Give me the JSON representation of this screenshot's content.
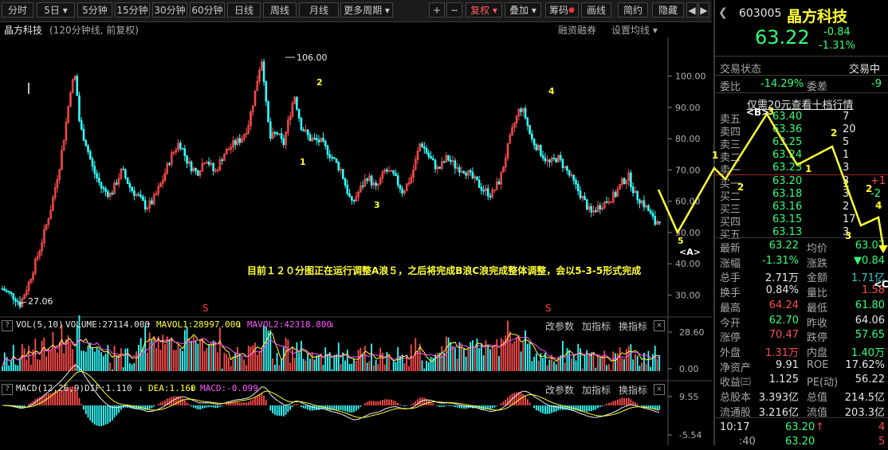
{
  "toolbar": {
    "periods": [
      "分时",
      "5日",
      "5分钟",
      "15分钟",
      "30分钟",
      "60分钟",
      "日线",
      "周线",
      "月线",
      "更多周期"
    ],
    "plus": "+",
    "minus": "−",
    "fuquan": "复权",
    "overlay": "叠加",
    "chips": "筹码",
    "draw": "画线",
    "simple": "简约",
    "hide": "隐藏",
    "prev_arrow": "◀",
    "next_arrow": "▶"
  },
  "chart": {
    "stock_name": "晶方科技",
    "sub_title": "(120分钟线, 前复权)",
    "margin_trading": "融资融券",
    "ma_settings": "设置均线",
    "annotation": "目前１２０分图正在运行调整A浪５，之后将完成B浪C浪完成整体调整，会以5-3-5形式完成",
    "high_label": "106.00",
    "low_label": "27.06",
    "wave_labels": [
      "1",
      "2",
      "3",
      "4",
      "5",
      "<A>",
      "S",
      "S"
    ]
  },
  "chart_data": {
    "type": "candlestick",
    "y_ticks": [
      "100.00",
      "90.00",
      "80.00",
      "70.00",
      "60.00",
      "50.00",
      "40.00",
      "30.00"
    ],
    "ylim": [
      27.06,
      106.0
    ],
    "high": 106.0,
    "low": 27.06,
    "waves": [
      {
        "label": "1",
        "price": 66
      },
      {
        "label": "2",
        "price": 95
      },
      {
        "label": "3",
        "price": 57
      },
      {
        "label": "4",
        "price": 91
      },
      {
        "label": "5",
        "price": 50
      },
      {
        "label": "<A>",
        "price": 50
      }
    ]
  },
  "volume_panel": {
    "title": "VOL(5,10)",
    "volume": "VOLUME:27114.000",
    "ma1": "MAVOL1:28997.000",
    "ma2": "MAVOL2:42318.800",
    "btn_params": "改参数",
    "btn_add": "加指标",
    "btn_switch": "换指标",
    "close": "✕",
    "y_ticks": [
      "28.60",
      "0.00"
    ]
  },
  "macd_panel": {
    "title": "MACD(12,26,9)",
    "dif": "DIF:1.110",
    "dea": "DEA:1.160",
    "macd": "MACD:-0.099",
    "btn_params": "改参数",
    "btn_add": "加指标",
    "btn_switch": "换指标",
    "close": "✕",
    "y_ticks": [
      "9.55",
      "-5.54"
    ]
  },
  "sidebar": {
    "code": "603005",
    "name": "晶方科技",
    "price": "63.22",
    "change": "-0.84",
    "change_pct": "-1.31%",
    "status_label": "交易状态",
    "status_value": "交易中",
    "webi_label": "委比",
    "webi_value": "-14.29%",
    "weicha_label": "委差",
    "weicha_value": "-9",
    "promo": "仅需20元查看十档行情",
    "asks": [
      {
        "label": "卖五",
        "price": "63.40",
        "vol": "7"
      },
      {
        "label": "卖四",
        "price": "63.36",
        "vol": "20"
      },
      {
        "label": "卖三",
        "price": "63.25",
        "vol": "5"
      },
      {
        "label": "卖二",
        "price": "63.24",
        "vol": "1"
      },
      {
        "label": "卖一",
        "price": "63.23",
        "vol": "3"
      }
    ],
    "bids": [
      {
        "label": "买一",
        "price": "63.20",
        "vol": "3",
        "delta": "+1"
      },
      {
        "label": "买二",
        "price": "63.18",
        "vol": "3",
        "delta": "-2"
      },
      {
        "label": "买三",
        "price": "63.16",
        "vol": "2",
        "delta": ""
      },
      {
        "label": "买四",
        "price": "63.15",
        "vol": "17",
        "delta": ""
      },
      {
        "label": "买五",
        "price": "63.13",
        "vol": "3",
        "delta": ""
      }
    ],
    "stats": [
      {
        "l1": "最新",
        "v1": "63.22",
        "c1": "green",
        "l2": "均价",
        "v2": "63.07",
        "c2": "green"
      },
      {
        "l1": "涨幅",
        "v1": "-1.31%",
        "c1": "green",
        "l2": "涨跌",
        "v2": "▼0.84",
        "c2": "green"
      },
      {
        "l1": "总手",
        "v1": "2.71万",
        "c1": "white",
        "l2": "金额",
        "v2": "1.71亿",
        "c2": "cyan"
      },
      {
        "l1": "换手",
        "v1": "0.84%",
        "c1": "white",
        "l2": "量比",
        "v2": "1.58",
        "c2": "red"
      },
      {
        "l1": "最高",
        "v1": "64.24",
        "c1": "red",
        "l2": "最低",
        "v2": "61.80",
        "c2": "green"
      },
      {
        "l1": "今开",
        "v1": "62.70",
        "c1": "green",
        "l2": "昨收",
        "v2": "64.06",
        "c2": "white"
      },
      {
        "l1": "涨停",
        "v1": "70.47",
        "c1": "red",
        "l2": "跌停",
        "v2": "57.65",
        "c2": "green"
      },
      {
        "l1": "外盘",
        "v1": "1.31万",
        "c1": "red",
        "l2": "内盘",
        "v2": "1.40万",
        "c2": "green"
      },
      {
        "l1": "净资产",
        "v1": "9.91",
        "c1": "white",
        "l2": "ROE",
        "v2": "17.62%",
        "c2": "white"
      },
      {
        "l1": "收益㈢",
        "v1": "1.125",
        "c1": "white",
        "l2": "PE(动)",
        "v2": "56.22",
        "c2": "white"
      },
      {
        "l1": "总股本",
        "v1": "3.393亿",
        "c1": "white",
        "l2": "总值",
        "v2": "214.5亿",
        "c2": "white"
      },
      {
        "l1": "流通股",
        "v1": "3.216亿",
        "c1": "white",
        "l2": "流值",
        "v2": "203.3亿",
        "c2": "white"
      }
    ],
    "tick": {
      "time": "10:17",
      "price": "63.20",
      "arrow": "↑",
      "vol": "4"
    },
    "tick2": {
      "time": ":40",
      "price": "63.20",
      "vol": "5"
    },
    "overlay_labels": [
      "<B>",
      "3",
      "1",
      "1",
      "2",
      "2",
      "1",
      "2",
      "3",
      "4",
      "<C>"
    ]
  },
  "colors": {
    "up": "#ff4c4c",
    "down": "#33ffff",
    "wave": "#ffff33",
    "bg": "#000000"
  }
}
